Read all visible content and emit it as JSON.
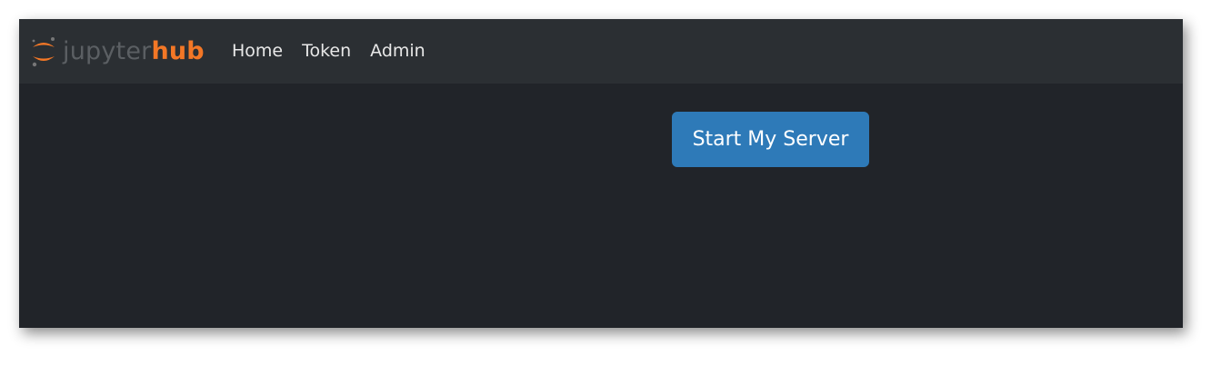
{
  "navbar": {
    "brand": {
      "icon": "jupyter-logo-icon",
      "text_jupyter": "jupyter",
      "text_hub": "hub"
    },
    "links": [
      {
        "label": "Home"
      },
      {
        "label": "Token"
      },
      {
        "label": "Admin"
      }
    ]
  },
  "main": {
    "start_button_label": "Start My Server"
  },
  "colors": {
    "navbar_bg": "#2b2f33",
    "page_bg": "#212429",
    "brand_orange": "#f37726",
    "button_blue": "#2e7ab8"
  }
}
